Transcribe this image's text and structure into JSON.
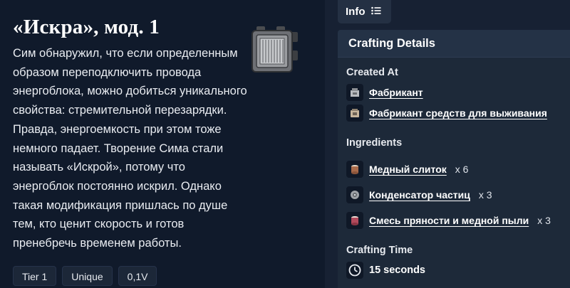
{
  "item": {
    "title": "«Искра», мод. 1",
    "description": "Сим обнаружил, что если определенным образом переподключить провода энергоблока, можно добиться уникального свойства: стремительной перезарядки. Правда, энергоемкость при этом тоже немного падает. Творение Сима стали называть «Искрой», потому что энергоблок постоянно искрил. Однако такая модификация пришлась по душе тем, кто ценит скорость и готов пренебречь временем работы.",
    "tags": [
      "Tier 1",
      "Unique",
      "0,1V"
    ]
  },
  "tab": {
    "label": "Info",
    "icon": "list-icon"
  },
  "crafting": {
    "header": "Crafting Details",
    "created_at_label": "Created At",
    "created_at": [
      {
        "name": "Фабрикант",
        "icon": "fabricator-icon"
      },
      {
        "name": "Фабрикант средств для выживания",
        "icon": "survival-fabricator-icon"
      }
    ],
    "ingredients_label": "Ingredients",
    "ingredients": [
      {
        "name": "Медный слиток",
        "qty": "x 6",
        "icon": "copper-ingot-icon"
      },
      {
        "name": "Конденсатор частиц",
        "qty": "x 3",
        "icon": "particle-capacitor-icon"
      },
      {
        "name": "Смесь пряности и медной пыли",
        "qty": "x 3",
        "icon": "spice-copper-dust-icon"
      }
    ],
    "time_label": "Crafting Time",
    "time_value": "15 seconds"
  }
}
